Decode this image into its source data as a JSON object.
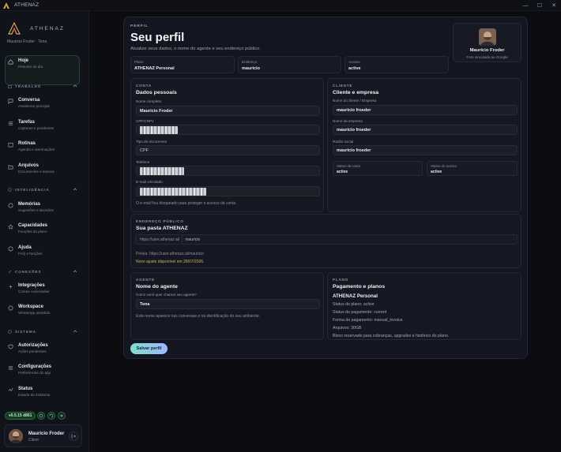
{
  "window": {
    "title": "ATHENAZ"
  },
  "sidebar": {
    "brand": "ATHENAZ",
    "user_line": "Mauricio Froder · Tena",
    "active": {
      "label": "Hoje",
      "sub": "Resumo do dia"
    },
    "sections": [
      {
        "title": "TRABALHO"
      },
      {
        "title": "INTELIGÊNCIA"
      },
      {
        "title": "CONEXÕES"
      },
      {
        "title": "SISTEMA"
      }
    ],
    "items": [
      {
        "label": "Conversa",
        "sub": "Assistente principal"
      },
      {
        "label": "Tarefas",
        "sub": "Capturas e pendentes"
      },
      {
        "label": "Rotinas",
        "sub": "Agenda e automações"
      },
      {
        "label": "Arquivos",
        "sub": "Documentos e anexos"
      },
      {
        "label": "Memórias",
        "sub": "Sugestões e decisões"
      },
      {
        "label": "Capacidades",
        "sub": "Funções do plano"
      },
      {
        "label": "Ajuda",
        "sub": "FAQ e funções"
      },
      {
        "label": "Integrações",
        "sub": "Contas conectadas"
      },
      {
        "label": "Workspace",
        "sub": "WhatsApp assistido"
      },
      {
        "label": "Autorizações",
        "sub": "Ações pendentes"
      },
      {
        "label": "Configurações",
        "sub": "Preferências do app"
      },
      {
        "label": "Status",
        "sub": "Estado da instância"
      }
    ],
    "version": "v0.5.15 d861",
    "user": {
      "name": "Mauricio Froder",
      "role": "Client"
    }
  },
  "profile": {
    "eyebrow": "PERFIL",
    "title": "Seu perfil",
    "subtitle": "Atualize seus dados, o nome do agente e seu endereço público.",
    "card": {
      "name": "Mauricio Froder",
      "note": "Foto vinculada ao Google"
    },
    "stats": [
      {
        "label": "Plano",
        "value": "ATHENAZ Personal"
      },
      {
        "label": "Endereço",
        "value": "mauricio"
      },
      {
        "label": "Acesso",
        "value": "active"
      }
    ]
  },
  "conta": {
    "eyebrow": "CONTA",
    "title": "Dados pessoais",
    "full_name_label": "Nome completo",
    "full_name": "Mauricio Froder",
    "cpf_label": "CPF/CNPJ",
    "doc_type_label": "Tipo de documento",
    "doc_type": "CPF",
    "phone_label": "Telefone",
    "email_label": "E-mail vinculado",
    "note": "O e-mail fica bloqueado para proteger o acesso da conta."
  },
  "cliente": {
    "eyebrow": "CLIENTE",
    "title": "Cliente e empresa",
    "client_label": "Nome do cliente / Empresa",
    "client": "mauricio froeder",
    "company_label": "Nome da empresa",
    "company": "mauricio froeder",
    "legal_label": "Razão social",
    "legal": "mauricio froeder",
    "account_status_label": "Status da conta",
    "account_status": "active",
    "access_status_label": "Status do acesso",
    "access_status": "active"
  },
  "endereco": {
    "eyebrow": "ENDEREÇO PÚBLICO",
    "title": "Sua pasta ATHENAZ",
    "prefix": "https://user.athenaz.ai/",
    "slug": "mauricio",
    "preview": "Prévia: https://user.athenaz.ai/mauricio",
    "warning": "Novo ajuste disponível em 28/07/2026."
  },
  "agente": {
    "eyebrow": "AGENTE",
    "title": "Nome do agente",
    "question": "Como você quer chamar seu agente?",
    "name": "Tena",
    "note": "Este nome aparece nas conversas e na identificação do seu ambiente."
  },
  "plano": {
    "eyebrow": "PLANO",
    "title": "Pagamento e planos",
    "name": "ATHENAZ Personal",
    "lines": [
      "Status do plano: active",
      "Status do pagamento: current",
      "Forma de pagamento: manual_invoice",
      "Arquivos: 30GB",
      "Bloco reservado para cobranças, upgrades e histórico do plano."
    ]
  },
  "actions": {
    "save": "Salvar perfil"
  },
  "colors": {
    "accent": "#7fe0c7",
    "warning": "#d9b45a",
    "success": "#2b6c3e"
  },
  "icons": [
    "home-icon",
    "chat-icon",
    "tasks-icon",
    "routine-icon",
    "folder-icon",
    "memory-icon",
    "capability-icon",
    "help-icon",
    "integration-icon",
    "workspace-icon",
    "shield-icon",
    "gear-icon",
    "status-icon",
    "logout-icon"
  ]
}
